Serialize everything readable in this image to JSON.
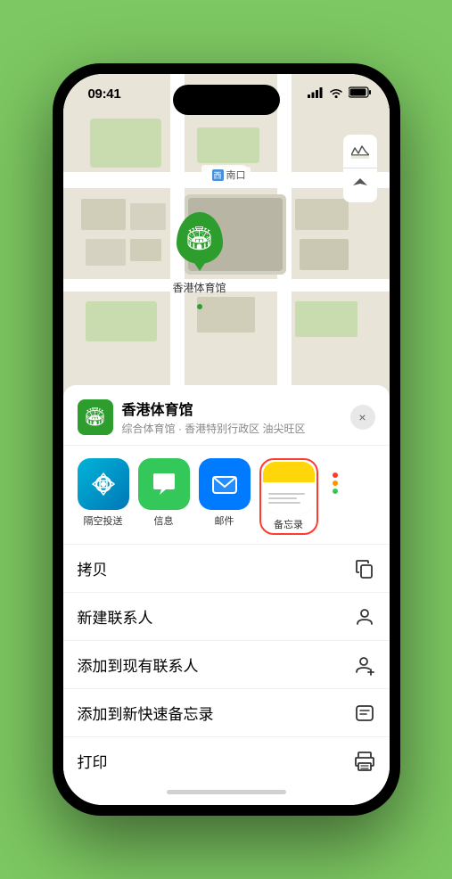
{
  "status_bar": {
    "time": "09:41",
    "signal_icon": "signal",
    "wifi_icon": "wifi",
    "battery_icon": "battery"
  },
  "map": {
    "label_north": "南口",
    "map_icon": "🗺",
    "location_icon": "⬆",
    "marker_label": "香港体育馆"
  },
  "venue_card": {
    "name": "香港体育馆",
    "subtitle": "综合体育馆 · 香港特别行政区 油尖旺区",
    "close_label": "×"
  },
  "app_icons": [
    {
      "id": "airdrop",
      "label": "隔空投送",
      "type": "airdrop"
    },
    {
      "id": "messages",
      "label": "信息",
      "type": "messages"
    },
    {
      "id": "mail",
      "label": "邮件",
      "type": "mail"
    },
    {
      "id": "notes",
      "label": "备忘录",
      "type": "notes",
      "selected": true
    }
  ],
  "actions": [
    {
      "id": "copy",
      "label": "拷贝",
      "icon": "📋"
    },
    {
      "id": "new-contact",
      "label": "新建联系人",
      "icon": "👤"
    },
    {
      "id": "add-existing",
      "label": "添加到现有联系人",
      "icon": "👤"
    },
    {
      "id": "add-notes",
      "label": "添加到新快速备忘录",
      "icon": "📝"
    },
    {
      "id": "print",
      "label": "打印",
      "icon": "🖨"
    }
  ],
  "colors": {
    "green_bg": "#7dc862",
    "marker_green": "#2d9e2d",
    "airdrop_blue": "#0077b6",
    "messages_green": "#34c759",
    "mail_blue": "#007aff",
    "notes_yellow": "#ffd60a",
    "selected_red": "#ff3b30"
  }
}
